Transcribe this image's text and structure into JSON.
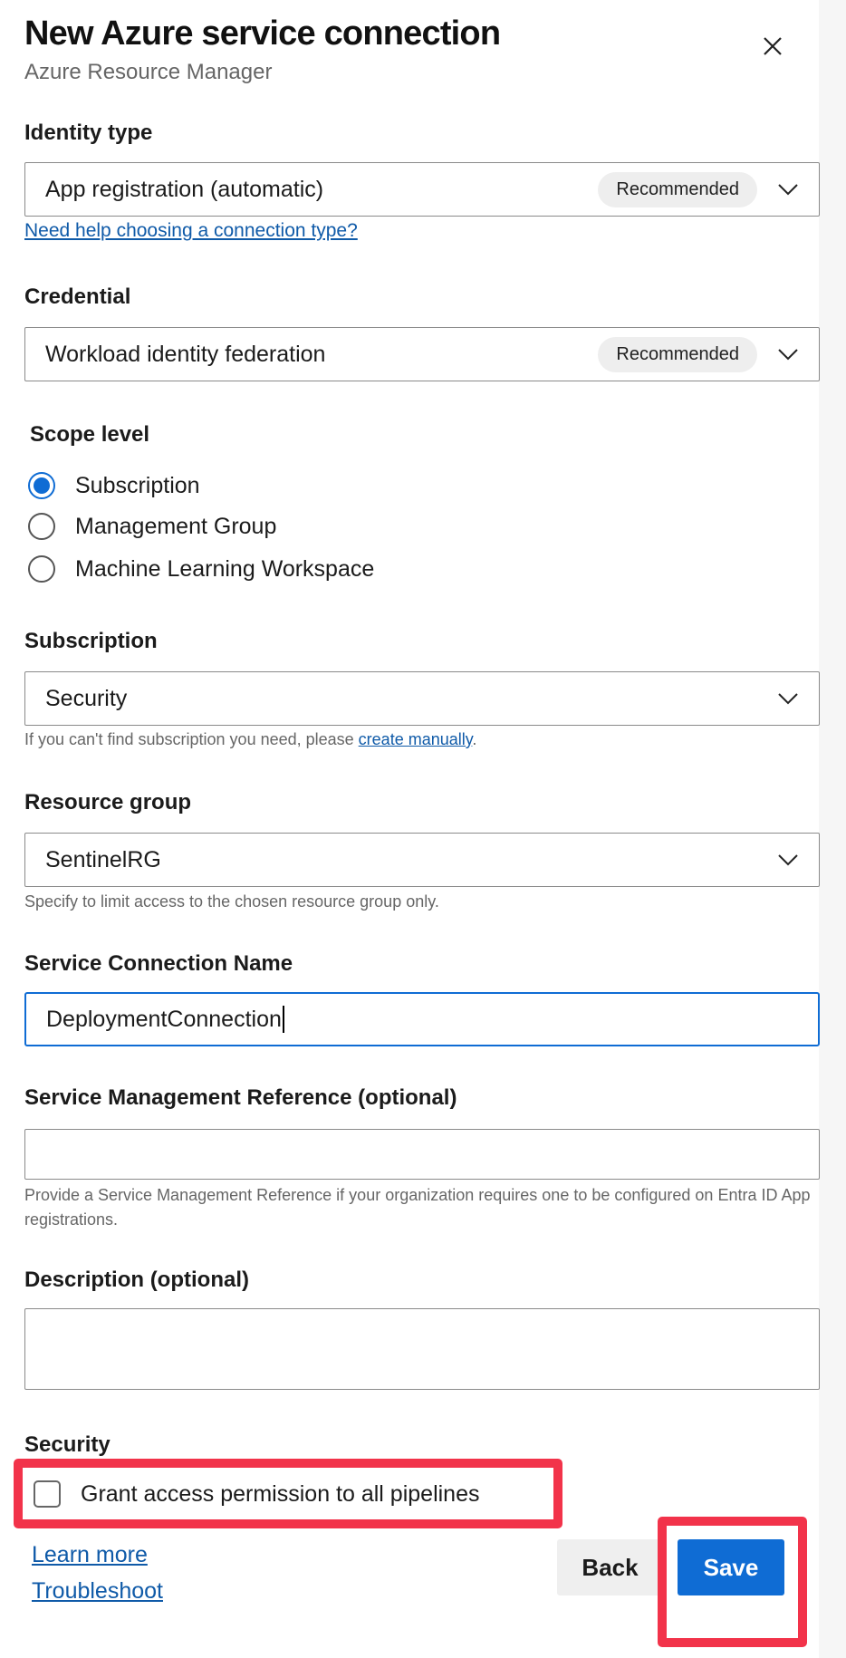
{
  "header": {
    "title": "New Azure service connection",
    "subtitle": "Azure Resource Manager",
    "close_icon": "close-icon"
  },
  "identity_type": {
    "label": "Identity type",
    "value": "App registration (automatic)",
    "badge": "Recommended",
    "help_link": "Need help choosing a connection type?"
  },
  "credential": {
    "label": "Credential",
    "value": "Workload identity federation",
    "badge": "Recommended"
  },
  "scope_level": {
    "label": "Scope level",
    "options": [
      {
        "label": "Subscription",
        "selected": true
      },
      {
        "label": "Management Group",
        "selected": false
      },
      {
        "label": "Machine Learning Workspace",
        "selected": false
      }
    ]
  },
  "subscription": {
    "label": "Subscription",
    "value": "Security",
    "help_prefix": "If you can't find subscription you need, please ",
    "help_link": "create manually",
    "help_suffix": "."
  },
  "resource_group": {
    "label": "Resource group",
    "value": "SentinelRG",
    "help": "Specify to limit access to the chosen resource group only."
  },
  "service_connection_name": {
    "label": "Service Connection Name",
    "value": "DeploymentConnection"
  },
  "service_management_reference": {
    "label": "Service Management Reference (optional)",
    "value": "",
    "help": "Provide a Service Management Reference if your organization requires one to be configured on Entra ID App registrations."
  },
  "description": {
    "label": "Description (optional)",
    "value": ""
  },
  "security": {
    "label": "Security",
    "checkbox_label": "Grant access permission to all pipelines",
    "checked": false
  },
  "footer": {
    "learn_more": "Learn more",
    "troubleshoot": "Troubleshoot",
    "back": "Back",
    "save": "Save"
  },
  "colors": {
    "accent": "#0f6cd4",
    "highlight": "#f2334a",
    "link": "#0f5aa8"
  }
}
